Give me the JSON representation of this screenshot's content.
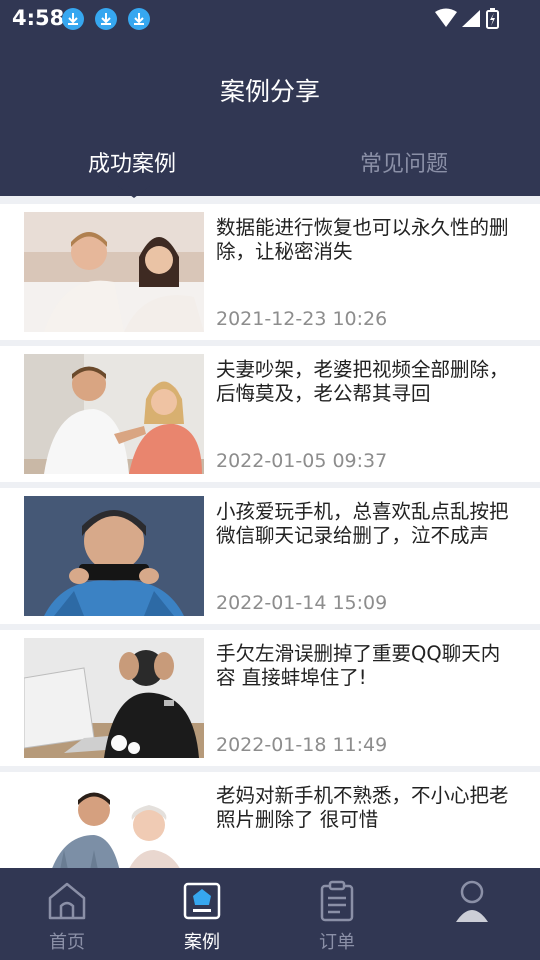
{
  "status_bar": {
    "time": "4:58"
  },
  "header": {
    "title": "案例分享"
  },
  "tabs": [
    {
      "label": "成功案例",
      "active": true
    },
    {
      "label": "常见问题",
      "active": false
    }
  ],
  "cases": [
    {
      "title": "数据能进行恢复也可以永久性的删除，让秘密消失",
      "date": "2021-12-23 10:26"
    },
    {
      "title": "夫妻吵架，老婆把视频全部删除，后悔莫及，老公帮其寻回",
      "date": "2022-01-05 09:37"
    },
    {
      "title": "小孩爱玩手机，总喜欢乱点乱按把微信聊天记录给删了，泣不成声",
      "date": "2022-01-14 15:09"
    },
    {
      "title": "手欠左滑误删掉了重要QQ聊天内容 直接蚌埠住了!",
      "date": "2022-01-18 11:49"
    },
    {
      "title": "老妈对新手机不熟悉，不小心把老照片删除了 很可惜",
      "date": ""
    }
  ],
  "bottom_nav": [
    {
      "label": "首页",
      "icon": "home-icon",
      "active": false
    },
    {
      "label": "案例",
      "icon": "case-icon",
      "active": true
    },
    {
      "label": "订单",
      "icon": "order-icon",
      "active": false
    },
    {
      "label": "",
      "icon": "profile-icon",
      "active": false
    }
  ],
  "colors": {
    "header_bg": "#313753",
    "download_badge": "#36a7f0",
    "inactive_text": "#8b90a7"
  }
}
